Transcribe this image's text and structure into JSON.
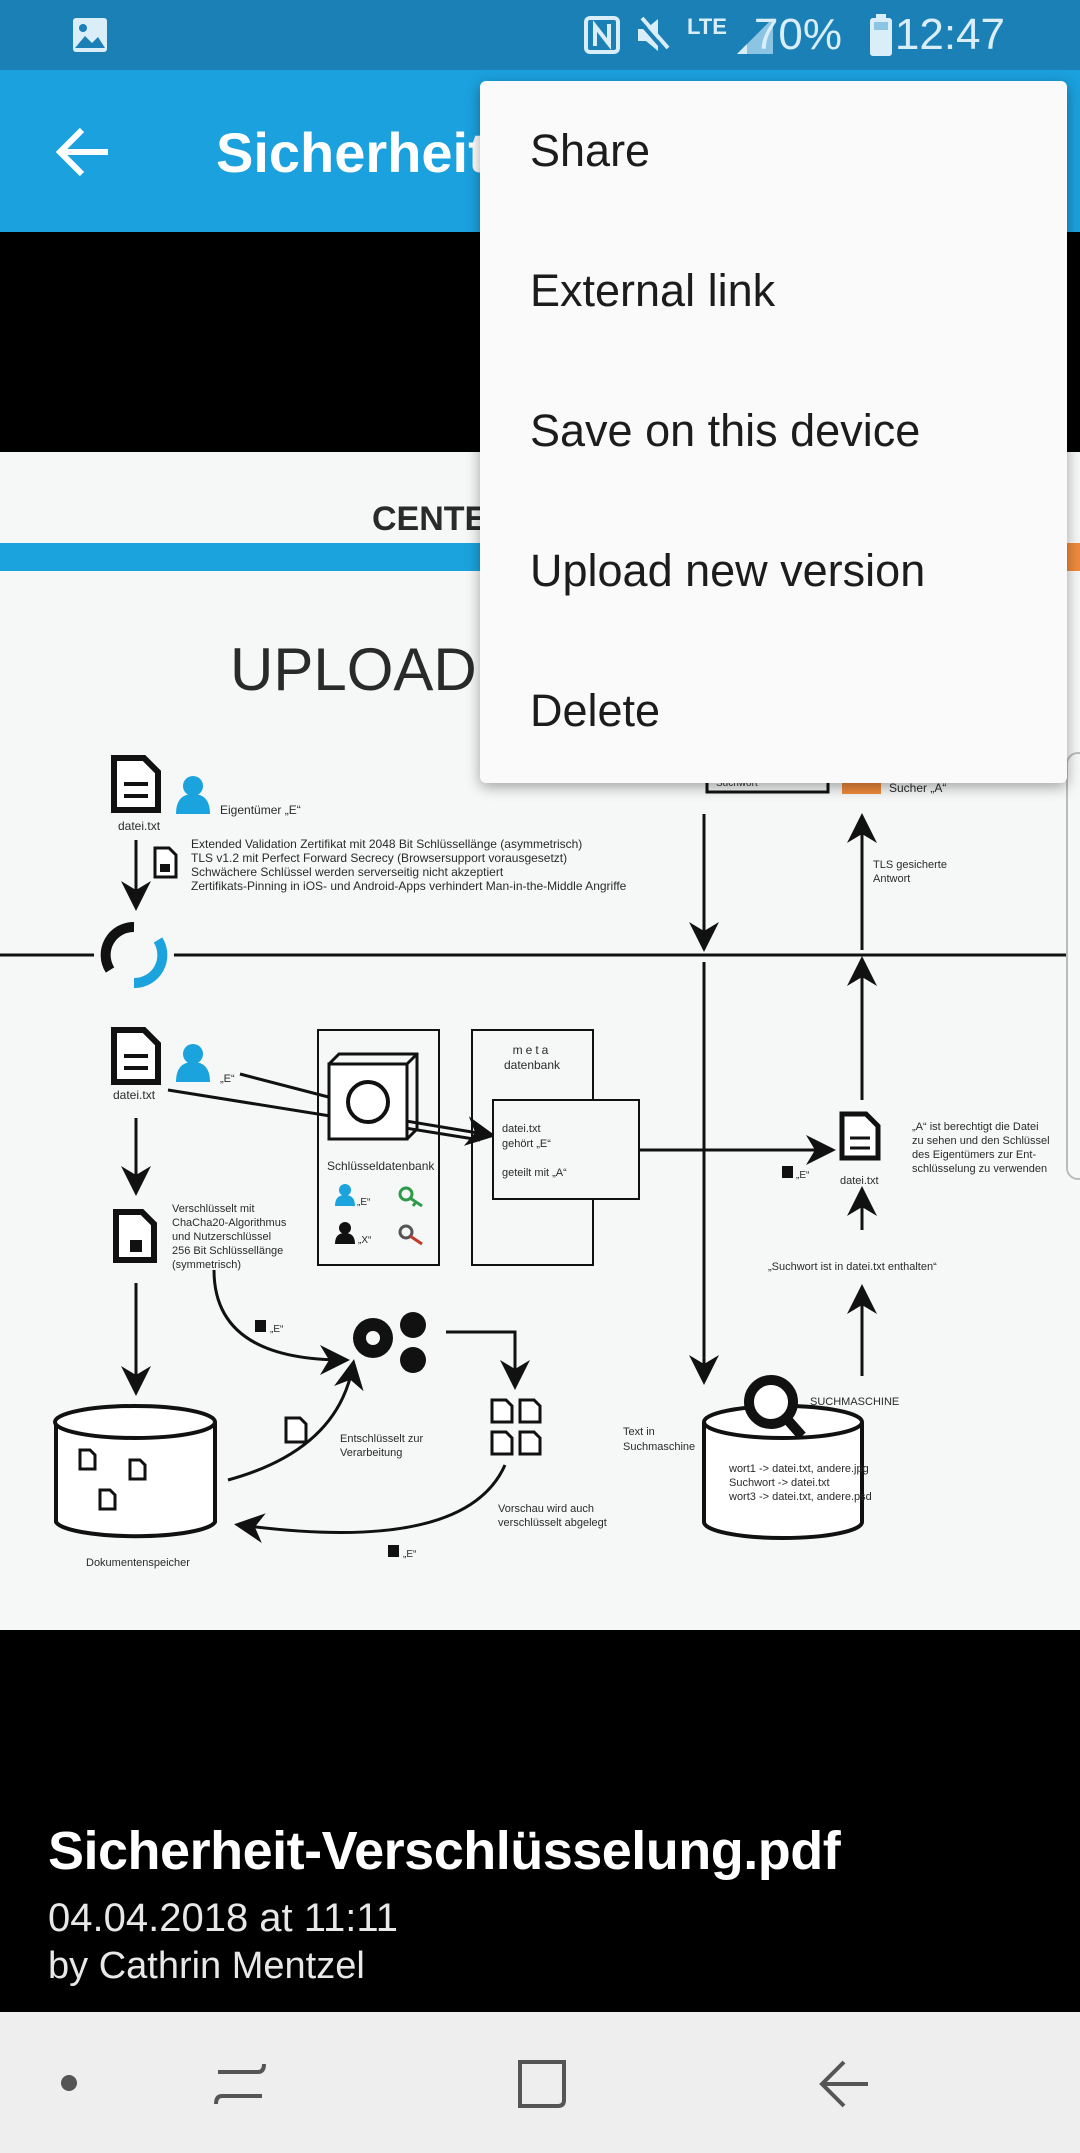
{
  "status_bar": {
    "battery": "70%",
    "time": "12:47",
    "network": "LTE",
    "icons": [
      "image-icon",
      "nfc-icon",
      "mute-icon",
      "lte-icon",
      "signal-icon",
      "battery-icon"
    ]
  },
  "app_bar": {
    "title": "Sicherheit-Verschlüsselung.pdf",
    "back_icon": "arrow-left-icon"
  },
  "menu": {
    "items": [
      {
        "label": "Share"
      },
      {
        "label": "External link"
      },
      {
        "label": "Save on this device"
      },
      {
        "label": "Upload new version"
      },
      {
        "label": "Delete"
      }
    ]
  },
  "document": {
    "header": "CENTE",
    "heading": "UPLOAD",
    "owner_label": "Eigentümer „E“",
    "file1": "datei.txt",
    "tls_lines": [
      "Extended Validation Zertifikat mit 2048 Bit Schlüssellänge (asymmetrisch)",
      "TLS v1.2 mit Perfect Forward Secrecy (Browsersupport vorausgesetzt)",
      "Schwächere Schlüssel werden serverseitig nicht akzeptiert",
      "Zertifikats-Pinning in iOS- und Android-Apps verhindert Man-in-the-Middle Angriffe"
    ],
    "search_word": "Suchwort",
    "searcher": "Sucher „A“",
    "tls_answer": [
      "TLS gesicherte",
      "Antwort"
    ],
    "e_label": "„E“",
    "x_label": "„X“",
    "key_db": "Schlüsseldatenbank",
    "meta_db": [
      "meta",
      "datenbank"
    ],
    "meta_lines": [
      "datei.txt",
      "gehört „E“",
      "geteilt mit „A“"
    ],
    "permission": [
      "„A“ ist berechtigt die Datei",
      "zu sehen und den Schlüssel",
      "des Eigentümers zur Ent-",
      "schlüsselung zu verwenden"
    ],
    "contains": "„Suchwort ist in datei.txt enthalten“",
    "encrypted": [
      "Verschlüsselt mit",
      "ChaCha20-Algorithmus",
      "und Nutzerschlüssel",
      "256 Bit Schlüssellänge",
      "(symmetrisch)"
    ],
    "decrypted": [
      "Entschlüsselt zur",
      "Verarbeitung"
    ],
    "preview": [
      "Vorschau wird auch",
      "verschlüsselt abgelegt"
    ],
    "storage": "Dokumentenspeicher",
    "search_engine": "SUCHMASCHINE",
    "text_in": [
      "Text in",
      "Suchmaschine"
    ],
    "index": [
      "wort1 -> datei.txt, andere.jpg",
      "Suchwort -> datei.txt",
      "wort3 -> datei.txt, andere.psd"
    ],
    "colors": {
      "blue": "#1aa3dc",
      "orange": "#ef8a3c",
      "green": "#2e9a4a",
      "red": "#c0392b"
    }
  },
  "file_info": {
    "name": "Sicherheit-Verschlüsselung.pdf",
    "date": "04.04.2018 at 11:11",
    "author": "by Cathrin Mentzel"
  },
  "nav_bar": {
    "icons": [
      "dot-icon",
      "recent-apps-icon",
      "home-icon",
      "back-icon"
    ]
  },
  "colors": {
    "status_bar": "#1a80b6",
    "app_bar": "#1ba1de"
  }
}
